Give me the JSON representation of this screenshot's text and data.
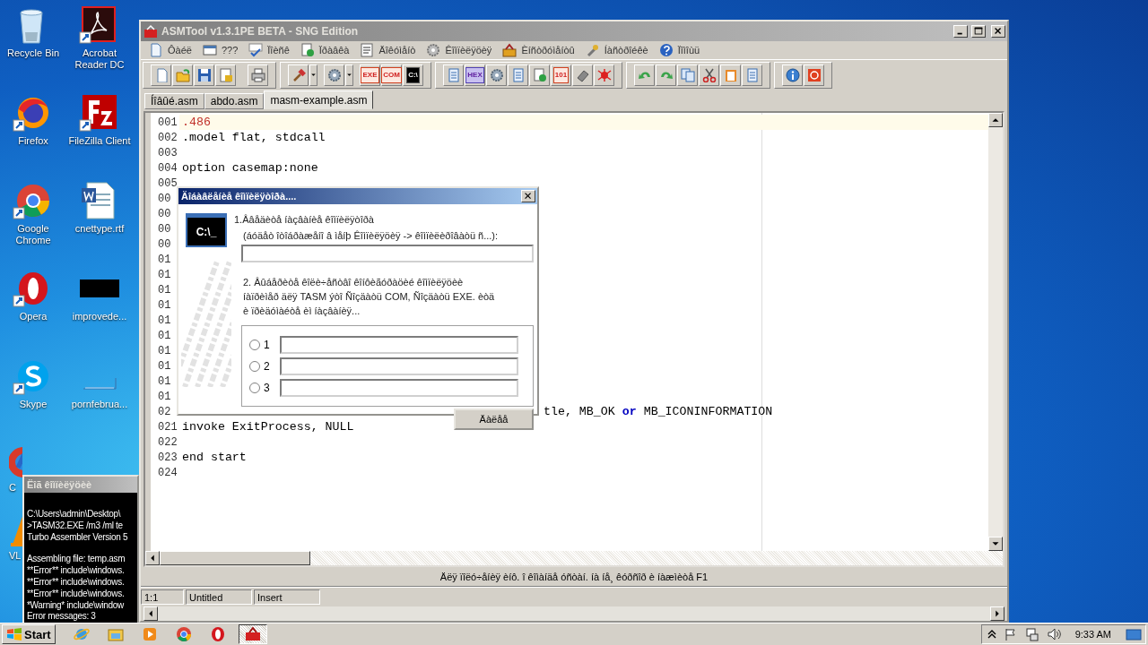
{
  "desktop": {
    "icons": [
      {
        "label": "Recycle Bin",
        "kind": "recycle",
        "shortcut": false
      },
      {
        "label": "Acrobat Reader DC",
        "kind": "pdf",
        "shortcut": true
      },
      {
        "label": "Firefox",
        "kind": "firefox",
        "shortcut": true
      },
      {
        "label": "FileZilla Client",
        "kind": "filezilla",
        "shortcut": true
      },
      {
        "label": "Google Chrome",
        "kind": "chrome",
        "shortcut": true
      },
      {
        "label": "cnettype.rtf",
        "kind": "word",
        "shortcut": false
      },
      {
        "label": "Opera",
        "kind": "opera",
        "shortcut": true
      },
      {
        "label": "improvede...",
        "kind": "dark-image",
        "shortcut": false
      },
      {
        "label": "Skype",
        "kind": "skype",
        "shortcut": true
      },
      {
        "label": "pornfebrua...",
        "kind": "blank-image",
        "shortcut": false
      }
    ],
    "partly_hidden_icons": [
      {
        "label": "C",
        "kind": "ccleaner"
      },
      {
        "label": "VL",
        "kind": "vlc"
      }
    ]
  },
  "window": {
    "title": "ASMTool v1.3.1PE BETA - SNG Edition",
    "active": false,
    "menu": [
      {
        "label": "Ôàéë",
        "kind": "file"
      },
      {
        "label": "???",
        "kind": "window"
      },
      {
        "label": "Ïîèñê",
        "kind": "spell"
      },
      {
        "label": "Ïðàâêà",
        "kind": "check"
      },
      {
        "label": "Äîêóìåíò",
        "kind": "document"
      },
      {
        "label": "Êîìïèëÿöèÿ",
        "kind": "gear"
      },
      {
        "label": "Èíñòðóìåíòû",
        "kind": "build"
      },
      {
        "label": "Íàñòðîéêè",
        "kind": "tools"
      },
      {
        "label": "Ïîìîùü",
        "kind": "help"
      }
    ],
    "toolbar": [
      [
        {
          "kind": "new"
        },
        {
          "kind": "open"
        },
        {
          "kind": "save"
        },
        {
          "kind": "lock"
        },
        {
          "kind": "print"
        }
      ],
      [
        {
          "kind": "hammer",
          "dropdown": true
        },
        {
          "kind": "gear",
          "dropdown": true
        },
        {
          "kind": "red-text",
          "glyph": "EXE"
        },
        {
          "kind": "red-text",
          "glyph": "COM"
        },
        {
          "kind": "console",
          "glyph": "C:\\"
        }
      ],
      [
        {
          "kind": "page"
        },
        {
          "kind": "hex",
          "glyph": "HEX"
        },
        {
          "kind": "gear"
        },
        {
          "kind": "page"
        },
        {
          "kind": "check"
        },
        {
          "kind": "red-text",
          "glyph": "101"
        },
        {
          "kind": "eraser"
        },
        {
          "kind": "bug"
        }
      ],
      [
        {
          "kind": "undo"
        },
        {
          "kind": "redo"
        },
        {
          "kind": "copy"
        },
        {
          "kind": "cut"
        },
        {
          "kind": "paste"
        },
        {
          "kind": "page"
        }
      ],
      [
        {
          "kind": "info"
        },
        {
          "kind": "power"
        }
      ]
    ],
    "tabs": [
      {
        "label": "Íîâûé.asm",
        "selected": false
      },
      {
        "label": "abdo.asm",
        "selected": false
      },
      {
        "label": "masm-example.asm",
        "selected": true
      }
    ],
    "lines": [
      {
        "number": "001",
        "current": true,
        "segments": [
          {
            "text": ".486",
            "kind": "directive"
          }
        ]
      },
      {
        "number": "002",
        "segments": [
          {
            "text": ".model flat, stdcall",
            "kind": "plain"
          }
        ]
      },
      {
        "number": "003"
      },
      {
        "number": "004",
        "segments": [
          {
            "text": "option casemap:none",
            "kind": "plain"
          }
        ]
      },
      {
        "number": "005"
      },
      {
        "number": "00"
      },
      {
        "number": "00"
      },
      {
        "number": "00"
      },
      {
        "number": "00"
      },
      {
        "number": "01"
      },
      {
        "number": "01"
      },
      {
        "number": "01"
      },
      {
        "number": "01"
      },
      {
        "number": "01"
      },
      {
        "number": "01"
      },
      {
        "number": "01"
      },
      {
        "number": "01"
      },
      {
        "number": "01"
      },
      {
        "number": "01"
      },
      {
        "number": "02",
        "covered": true,
        "segments": [
          {
            "text": "tle, MB_OK ",
            "kind": "plain"
          },
          {
            "text": "or",
            "kind": "keyword"
          },
          {
            "text": " MB_ICONINFORMATION",
            "kind": "plain"
          }
        ]
      },
      {
        "number": "021",
        "segments": [
          {
            "text": "invoke ExitProcess, NULL",
            "kind": "plain"
          }
        ]
      },
      {
        "number": "022"
      },
      {
        "number": "023",
        "segments": [
          {
            "text": "end start",
            "kind": "plain"
          }
        ]
      },
      {
        "number": "024"
      }
    ],
    "status_message": "Äëÿ ïîëó÷åíèÿ èíô. î êîìàíäå óñòàí. íà íå¸ êóðñîð è íàæìèòå F1",
    "status_panes": [
      "1:1",
      "Untitled",
      "Insert"
    ]
  },
  "dialog": {
    "title": "Äîáàâëåíèå êîìïèëÿòîðà....",
    "active": true,
    "icon_text": "C:\\_",
    "step1": "1.Ââåäèòå íàçâàíèå êîìïèëÿòîðà",
    "step1_hint": "(áóäåò îòîáðàæåíî â ìåíþ Êîìïèëÿöèÿ -> êîìïèëèðîâàòü ñ...):",
    "step2": "2. Âûáåðèòå êîëè÷åñòâî êîíôèãóðàöèé êîìïèëÿöèè\níàïðèìåð äëÿ TASM ýòî Ñîçäàòü COM, Ñîçäàòü EXE. èòä\nè ïðèäóìàéòå èì íàçâàíèÿ...",
    "options": [
      {
        "label": "1",
        "selected": false
      },
      {
        "label": "2",
        "selected": false
      },
      {
        "label": "3",
        "selected": false
      }
    ],
    "button": "Äàëåå"
  },
  "console": {
    "title": "Ëîã êîìïèëÿöèè",
    "active": false,
    "blocks": [
      [
        "C:\\Users\\admin\\Desktop\\",
        ">TASM32.EXE /m3 /ml te",
        "Turbo Assembler  Version 5"
      ],
      [
        "Assembling file:   temp.asm",
        "**Error** include\\windows.",
        "**Error** include\\windows.",
        "**Error** include\\windows.",
        "*Warning* include\\window",
        "Error messages:    3"
      ]
    ]
  },
  "taskbar": {
    "start": "Start",
    "apps": [
      {
        "kind": "ie",
        "selected": false
      },
      {
        "kind": "explorer",
        "selected": false
      },
      {
        "kind": "media",
        "selected": false
      },
      {
        "kind": "chrome",
        "selected": false
      },
      {
        "kind": "opera",
        "selected": false
      },
      {
        "kind": "asmtool",
        "selected": true
      }
    ],
    "clock": "9:33 AM"
  }
}
